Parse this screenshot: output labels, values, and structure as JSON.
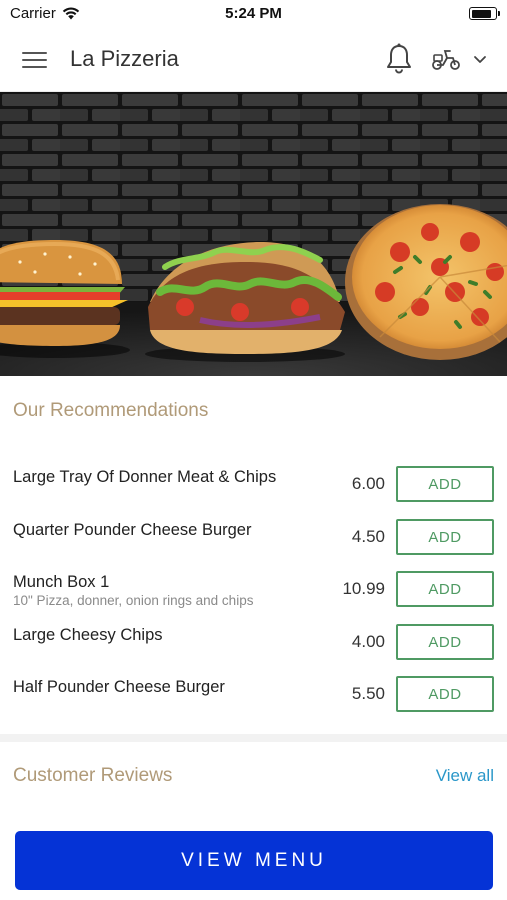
{
  "status_bar": {
    "carrier": "Carrier",
    "time": "5:24 PM",
    "battery_level": 0.9
  },
  "header": {
    "title": "La Pizzeria",
    "icons": [
      "menu-icon",
      "bell-icon",
      "scooter-icon",
      "chevron-down-icon"
    ]
  },
  "hero": {
    "images": [
      "burger",
      "doner-kebab",
      "pizza"
    ]
  },
  "recommendations": {
    "title": "Our Recommendations",
    "items": [
      {
        "name": "Large Tray Of Donner Meat & Chips",
        "description": "",
        "price": "6.00",
        "button": "ADD"
      },
      {
        "name": "Quarter Pounder Cheese Burger",
        "description": "",
        "price": "4.50",
        "button": "ADD"
      },
      {
        "name": "Munch Box 1",
        "description": "10\" Pizza, donner, onion rings and chips",
        "price": "10.99",
        "button": "ADD"
      },
      {
        "name": "Large Cheesy Chips",
        "description": "",
        "price": "4.00",
        "button": "ADD"
      },
      {
        "name": "Half Pounder Cheese Burger",
        "description": "",
        "price": "5.50",
        "button": "ADD"
      }
    ]
  },
  "reviews": {
    "title": "Customer Reviews",
    "view_all": "View all"
  },
  "footer": {
    "view_menu": "VIEW MENU"
  },
  "colors": {
    "accent_gold": "#b09a78",
    "add_green": "#4f9a63",
    "link_blue": "#2a97c9",
    "primary_blue": "#0533d6"
  }
}
